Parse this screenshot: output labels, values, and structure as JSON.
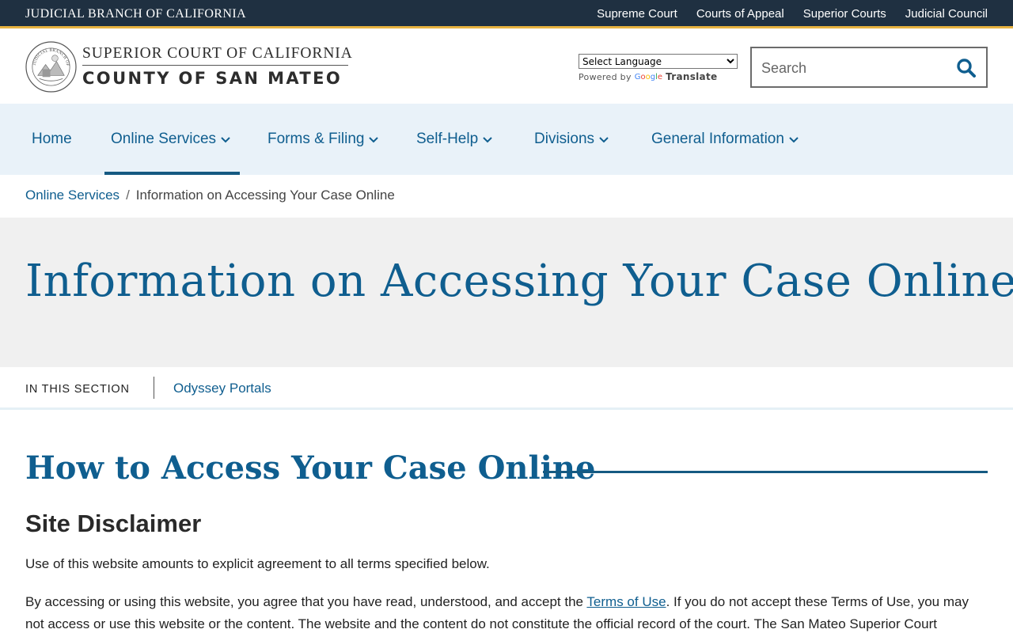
{
  "topbar": {
    "brand": "JUDICIAL BRANCH OF CALIFORNIA",
    "links": [
      "Supreme Court",
      "Courts of Appeal",
      "Superior Courts",
      "Judicial Council"
    ]
  },
  "header": {
    "seal_text": "JUDICIAL BRANCH OF CALIFORNIA",
    "title_line1": "SUPERIOR COURT OF CALIFORNIA",
    "title_line2": "COUNTY OF SAN MATEO",
    "translate": {
      "select_label": "Select Language",
      "powered_by": "Powered by",
      "google": "Google",
      "translate": "Translate"
    },
    "search": {
      "placeholder": "Search",
      "value": ""
    }
  },
  "nav": {
    "items": [
      {
        "label": "Home"
      },
      {
        "label": "Online Services"
      },
      {
        "label": "Forms & Filing"
      },
      {
        "label": "Self-Help"
      },
      {
        "label": "Divisions"
      },
      {
        "label": "General Information"
      }
    ],
    "active": "Online Services"
  },
  "breadcrumb": {
    "parent": "Online Services",
    "separator": "/",
    "current": "Information on Accessing Your Case Online"
  },
  "hero": {
    "title": "Information on Accessing Your Case Online"
  },
  "section_nav": {
    "label": "IN THIS SECTION",
    "link": "Odyssey Portals"
  },
  "content": {
    "heading": "How to Access Your Case Online",
    "subheading": "Site Disclaimer",
    "para1": "Use of this website amounts to explicit agreement to all terms specified below.",
    "para2_before": "By accessing or using this website, you agree that you have read, understood, and accept the ",
    "para2_link": "Terms of Use",
    "para2_after": ".  If you do not accept these Terms of Use, you may not access or use this website or the content. The website and the content do not constitute the official record of the court. The San Mateo Superior Court maintains this website as"
  },
  "colors": {
    "topbar_bg": "#1f3041",
    "topbar_accent": "#e7b340",
    "primary_blue": "#0f5e8f",
    "nav_bg": "#e9f2f9",
    "hero_bg": "#f0f0f0"
  }
}
